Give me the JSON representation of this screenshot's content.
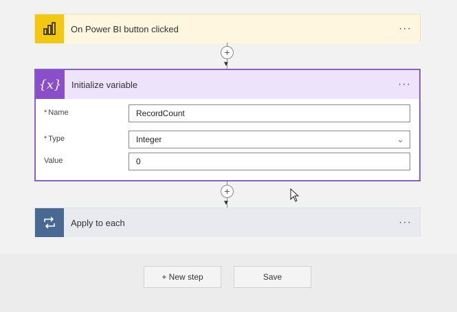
{
  "trigger": {
    "title": "On Power BI button clicked",
    "more": "···"
  },
  "init": {
    "title": "Initialize variable",
    "icon_text": "{x}",
    "more": "···",
    "fields": [
      {
        "label": "Name",
        "required": "*",
        "value": "RecordCount"
      },
      {
        "label": "Type",
        "required": "*",
        "value": "Integer"
      },
      {
        "label": "Value",
        "required": "",
        "value": "0"
      }
    ]
  },
  "apply": {
    "title": "Apply to each",
    "more": "···"
  },
  "connectors": {
    "plus": "+",
    "arrow": "▼"
  },
  "buttons": {
    "new_step": "+ New step",
    "save": "Save"
  },
  "colors": {
    "trigger_icon": "#f2c811",
    "init_accent": "#8661c5",
    "apply_icon": "#486991"
  }
}
